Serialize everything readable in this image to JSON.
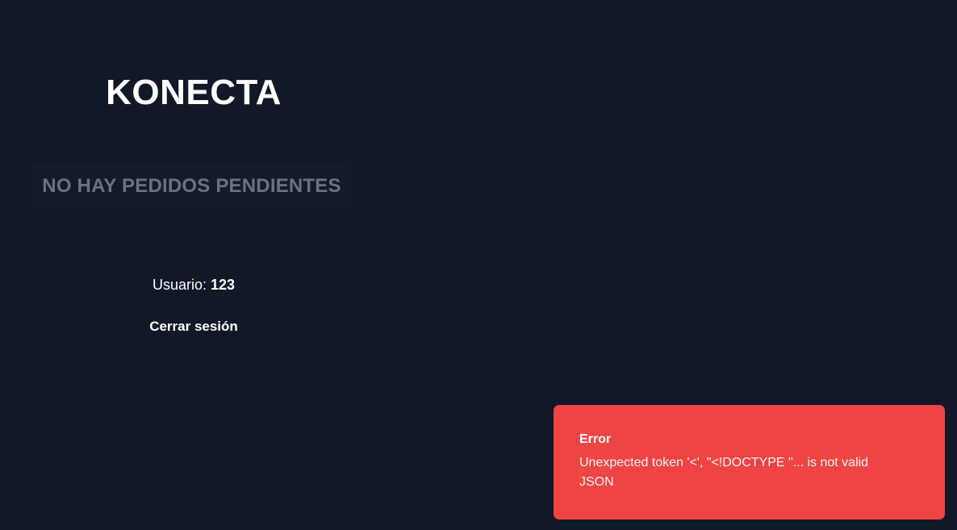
{
  "app": {
    "brand": "KONECTA"
  },
  "orders": {
    "empty_message": "NO HAY PEDIDOS PENDIENTES"
  },
  "user": {
    "label": "Usuario:",
    "value": "123"
  },
  "actions": {
    "logout_label": "Cerrar sesión"
  },
  "toast": {
    "title": "Error",
    "message": "Unexpected token '<', \"<!DOCTYPE \"... is not valid JSON",
    "color": "#ef4444"
  },
  "theme": {
    "background": "#111827",
    "muted_text": "#6b7280"
  }
}
